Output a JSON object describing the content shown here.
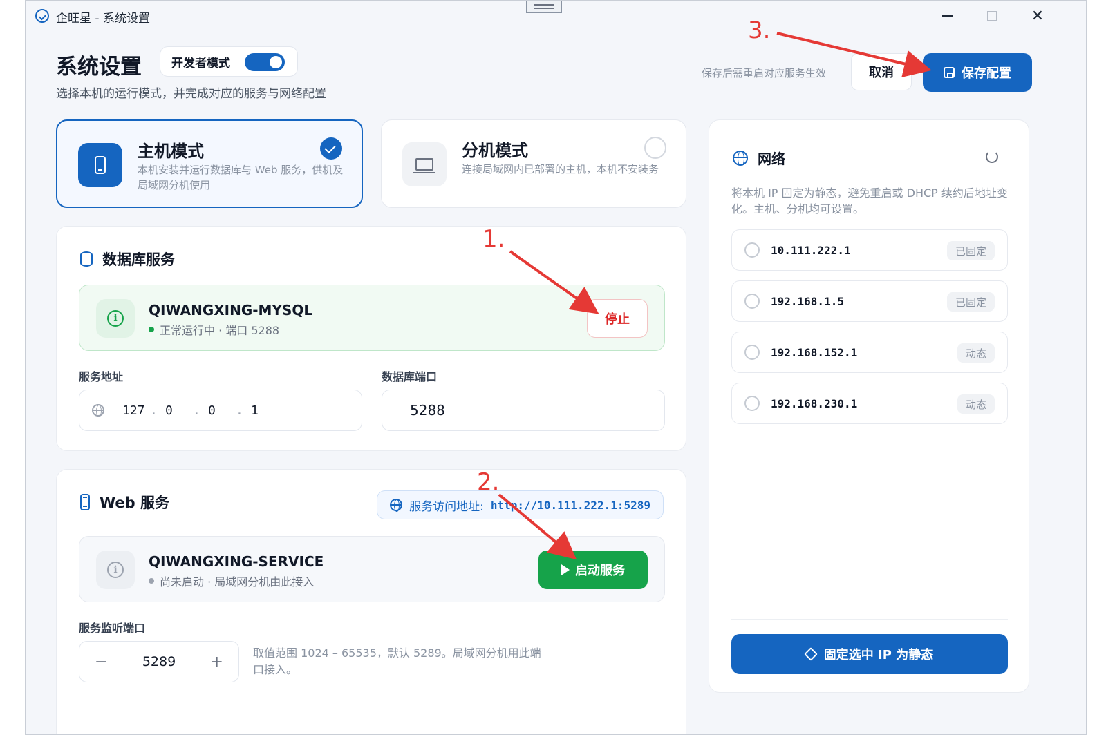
{
  "window": {
    "title": "企旺星 - 系统设置"
  },
  "header": {
    "title": "系统设置",
    "dev_mode_label": "开发者模式",
    "dev_mode_on": true,
    "subtitle": "选择本机的运行模式，并完成对应的服务与网络配置",
    "save_hint": "保存后需重启对应服务生效",
    "cancel_label": "取消",
    "save_label": "保存配置"
  },
  "modes": {
    "host": {
      "title": "主机模式",
      "desc": "本机安装并运行数据库与 Web 服务，供机及局域网分机使用",
      "selected": true
    },
    "client": {
      "title": "分机模式",
      "desc": "连接局域网内已部署的主机，本机不安装务",
      "selected": false
    }
  },
  "database": {
    "section_title": "数据库服务",
    "service_name": "QIWANGXING-MYSQL",
    "status": "正常运行中 · 端口 5288",
    "stop_label": "停止",
    "address_label": "服务地址",
    "ip": [
      "127",
      "0",
      "0",
      "1"
    ],
    "port_label": "数据库端口",
    "port": "5288"
  },
  "web": {
    "section_title": "Web 服务",
    "url_label": "服务访问地址:",
    "url": "http://10.111.222.1:5289",
    "service_name": "QIWANGXING-SERVICE",
    "status": "尚未启动 · 局域网分机由此接入",
    "start_label": "启动服务",
    "listen_port_label": "服务监听端口",
    "listen_port": "5289",
    "minus": "−",
    "plus": "+",
    "port_hint": "取值范围 1024 – 65535，默认 5289。局域网分机用此端口接入。"
  },
  "network": {
    "title": "网络",
    "desc": "将本机 IP 固定为静态，避免重启或 DHCP 续约后地址变化。主机、分机均可设置。",
    "ips": [
      {
        "addr": "10.111.222.1",
        "badge": "已固定"
      },
      {
        "addr": "192.168.1.5",
        "badge": "已固定"
      },
      {
        "addr": "192.168.152.1",
        "badge": "动态"
      },
      {
        "addr": "192.168.230.1",
        "badge": "动态"
      }
    ],
    "pin_label": "固定选中 IP 为静态"
  },
  "annotations": {
    "step1": "1.",
    "step2": "2.",
    "step3": "3.",
    "color": "#e53935"
  },
  "colors": {
    "accent": "#1565c0",
    "success": "#16a34a",
    "danger": "#dc2626"
  }
}
